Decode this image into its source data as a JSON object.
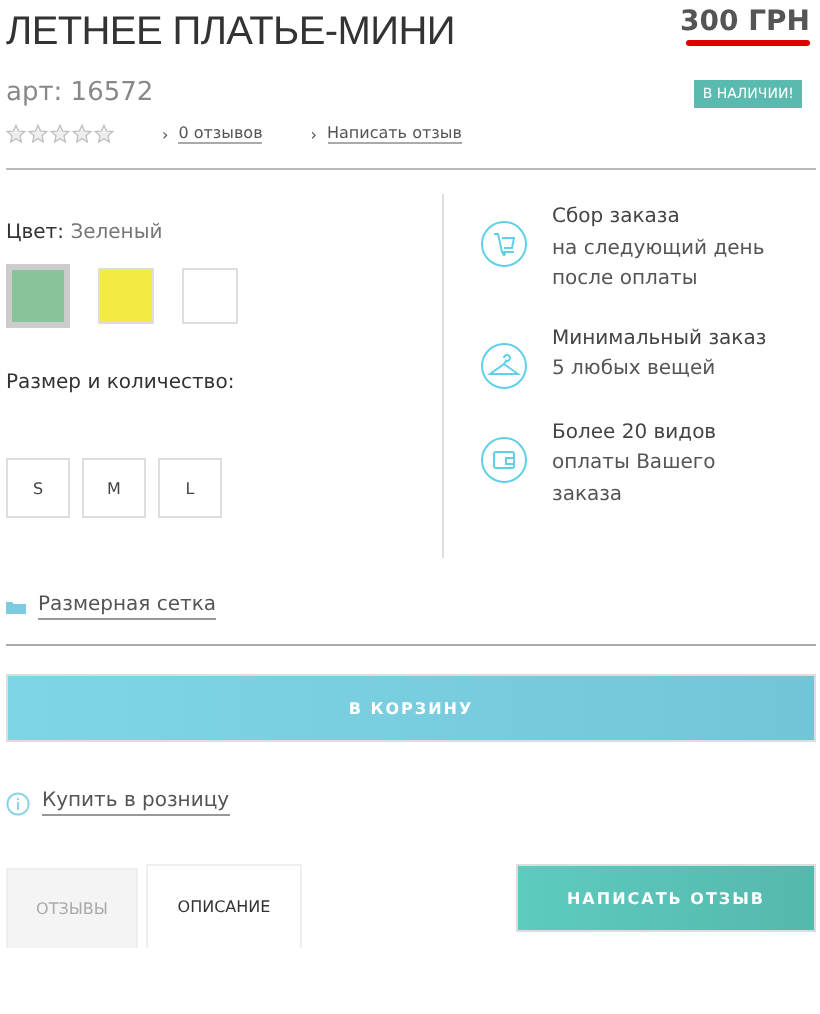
{
  "product": {
    "title": "ЛЕТНЕЕ ПЛАТЬЕ-МИНИ",
    "price": "300 ГРН",
    "sku": "арт: 16572",
    "availability": "В НАЛИЧИИ!",
    "stars": 0,
    "links": [
      {
        "chevron": "›",
        "label": "0 отзывов"
      },
      {
        "chevron": "›",
        "label": "Написать отзыв"
      }
    ]
  },
  "color": {
    "label": "Цвет:",
    "value": "Зеленый",
    "swatches": [
      {
        "color": "#88c399",
        "selected": true
      },
      {
        "color": "#f3ea44",
        "selected": false
      },
      {
        "color": "#ffffff",
        "selected": false
      }
    ]
  },
  "size": {
    "label": "Размер и количество:",
    "options": [
      {
        "label": "S",
        "selected": false
      },
      {
        "label": "M",
        "selected": false
      },
      {
        "label": "L",
        "selected": false
      }
    ]
  },
  "features": [
    {
      "kind": "cart",
      "lines": [
        "Сбор заказа",
        "на следующий день",
        "после оплаты"
      ]
    },
    {
      "kind": "hanger",
      "lines": [
        "Минимальный заказ",
        "5 любых вещей"
      ]
    },
    {
      "kind": "wallet",
      "lines": [
        "Более 20 видов",
        "оплаты Вашего",
        "заказа"
      ]
    }
  ],
  "size_chart_link": "Размерная сетка",
  "cart_button": "В КОРЗИНУ",
  "retail_link": "Купить в розницу",
  "tabs": [
    {
      "label": "ОТЗЫВЫ",
      "selected": false
    },
    {
      "label": "ОПИСАНИЕ",
      "selected": true
    }
  ],
  "write_review_button": "НАПИСАТЬ ОТЗЫВ"
}
